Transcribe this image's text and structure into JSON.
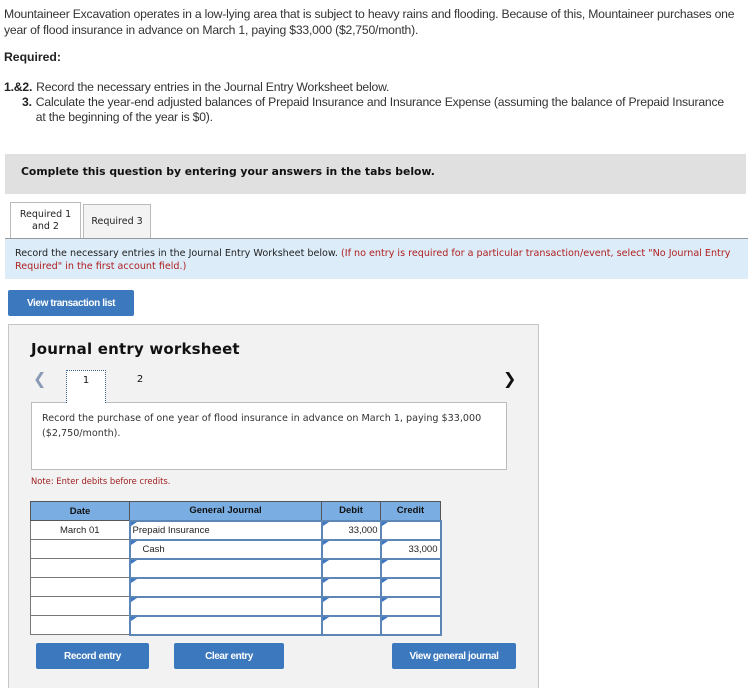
{
  "problem": {
    "intro": "Mountaineer Excavation operates in a low-lying area that is subject to heavy rains and flooding. Because of this, Mountaineer purchases one year of flood insurance in advance on March 1, paying $33,000 ($2,750/month).",
    "required_title": "Required:",
    "requirements": [
      {
        "num": "1.&2.",
        "text": "Record the necessary entries in the Journal Entry Worksheet below."
      },
      {
        "num": "3.",
        "text": "Calculate the year-end adjusted balances of Prepaid Insurance and Insurance Expense (assuming the balance of Prepaid Insurance at the beginning of the year is $0)."
      }
    ]
  },
  "banner": "Complete this question by entering your answers in the tabs below.",
  "tabs": [
    {
      "label": "Required 1 and 2",
      "active": true
    },
    {
      "label": "Required 3",
      "active": false
    }
  ],
  "instructions": {
    "main": "Record the necessary entries in the Journal Entry Worksheet below.",
    "note": "(If no entry is required for a particular transaction/event, select \"No Journal Entry Required\" in the first account field.)"
  },
  "view_transaction_list": "View transaction list",
  "worksheet": {
    "title": "Journal entry worksheet",
    "nav_prev_icon": "chevron-left-icon",
    "nav_next_icon": "chevron-right-icon",
    "pages": [
      "1",
      "2"
    ],
    "active_page": "1",
    "description": "Record the purchase of one year of flood insurance in advance on March 1, paying $33,000 ($2,750/month).",
    "note": "Note: Enter debits before credits.",
    "columns": [
      "Date",
      "General Journal",
      "Debit",
      "Credit"
    ],
    "rows": [
      {
        "date": "March 01",
        "account": "Prepaid Insurance",
        "debit": "33,000",
        "credit": ""
      },
      {
        "date": "",
        "account": "Cash",
        "debit": "",
        "credit": "33,000"
      },
      {
        "date": "",
        "account": "",
        "debit": "",
        "credit": ""
      },
      {
        "date": "",
        "account": "",
        "debit": "",
        "credit": ""
      },
      {
        "date": "",
        "account": "",
        "debit": "",
        "credit": ""
      },
      {
        "date": "",
        "account": "",
        "debit": "",
        "credit": ""
      }
    ],
    "buttons": {
      "record": "Record entry",
      "clear": "Clear entry",
      "view_journal": "View general journal"
    }
  }
}
